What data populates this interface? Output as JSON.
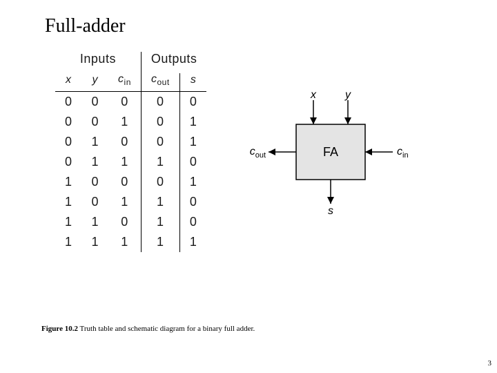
{
  "title": "Full-adder",
  "truth_table": {
    "group_inputs": "Inputs",
    "group_outputs": "Outputs",
    "cols": {
      "x": "x",
      "y": "y",
      "cin": "c",
      "cin_sub": "in",
      "cout": "c",
      "cout_sub": "out",
      "s": "s"
    },
    "rows": [
      {
        "x": "0",
        "y": "0",
        "cin": "0",
        "cout": "0",
        "s": "0"
      },
      {
        "x": "0",
        "y": "0",
        "cin": "1",
        "cout": "0",
        "s": "1"
      },
      {
        "x": "0",
        "y": "1",
        "cin": "0",
        "cout": "0",
        "s": "1"
      },
      {
        "x": "0",
        "y": "1",
        "cin": "1",
        "cout": "1",
        "s": "0"
      },
      {
        "x": "1",
        "y": "0",
        "cin": "0",
        "cout": "0",
        "s": "1"
      },
      {
        "x": "1",
        "y": "0",
        "cin": "1",
        "cout": "1",
        "s": "0"
      },
      {
        "x": "1",
        "y": "1",
        "cin": "0",
        "cout": "1",
        "s": "0"
      },
      {
        "x": "1",
        "y": "1",
        "cin": "1",
        "cout": "1",
        "s": "1"
      }
    ]
  },
  "schematic": {
    "box_label": "FA",
    "x": "x",
    "y": "y",
    "cin": "c",
    "cin_sub": "in",
    "cout": "c",
    "cout_sub": "out",
    "s": "s"
  },
  "caption": {
    "fig": "Figure 10.2",
    "text": " Truth table and schematic diagram for a binary full adder."
  },
  "page_number": "3",
  "chart_data": {
    "type": "table",
    "title": "Binary full adder truth table",
    "columns": [
      "x",
      "y",
      "c_in",
      "c_out",
      "s"
    ],
    "rows": [
      [
        0,
        0,
        0,
        0,
        0
      ],
      [
        0,
        0,
        1,
        0,
        1
      ],
      [
        0,
        1,
        0,
        0,
        1
      ],
      [
        0,
        1,
        1,
        1,
        0
      ],
      [
        1,
        0,
        0,
        0,
        1
      ],
      [
        1,
        0,
        1,
        1,
        0
      ],
      [
        1,
        1,
        0,
        1,
        0
      ],
      [
        1,
        1,
        1,
        1,
        1
      ]
    ]
  }
}
